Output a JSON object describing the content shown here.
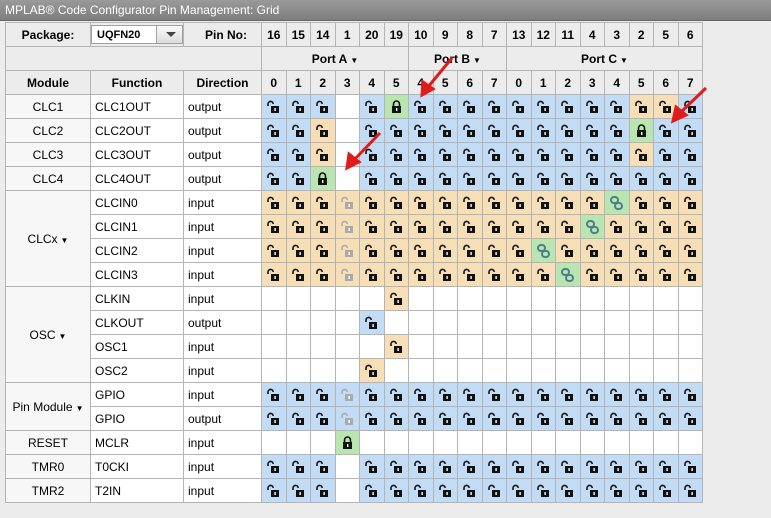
{
  "window": {
    "title": "MPLAB® Code Configurator Pin Management: Grid"
  },
  "package": {
    "label": "Package:",
    "value": "UQFN20"
  },
  "pin_no_label": "Pin No:",
  "pin_numbers": [
    "16",
    "15",
    "14",
    "1",
    "20",
    "19",
    "10",
    "9",
    "8",
    "7",
    "13",
    "12",
    "11",
    "4",
    "3",
    "2",
    "5",
    "6"
  ],
  "ports": [
    {
      "label": "Port A",
      "indices": [
        "0",
        "1",
        "2",
        "3",
        "4",
        "5"
      ]
    },
    {
      "label": "Port B",
      "indices": [
        "4",
        "5",
        "6",
        "7"
      ]
    },
    {
      "label": "Port C",
      "indices": [
        "0",
        "1",
        "2",
        "3",
        "4",
        "5",
        "6",
        "7"
      ]
    }
  ],
  "headers": {
    "module": "Module",
    "function": "Function",
    "direction": "Direction"
  },
  "modules": [
    {
      "name": "CLC1",
      "dropdown": false,
      "rows": [
        {
          "function": "CLC1OUT",
          "direction": "output",
          "cells": "bbbwbGbbbbbbbbboob"
        }
      ]
    },
    {
      "name": "CLC2",
      "dropdown": false,
      "rows": [
        {
          "function": "CLC2OUT",
          "direction": "output",
          "cells": "bbowbbbbbbbbbbbGbb"
        }
      ]
    },
    {
      "name": "CLC3",
      "dropdown": false,
      "rows": [
        {
          "function": "CLC3OUT",
          "direction": "output",
          "cells": "bbowbbbbbbbbbbbobb"
        }
      ]
    },
    {
      "name": "CLC4",
      "dropdown": false,
      "rows": [
        {
          "function": "CLC4OUT",
          "direction": "output",
          "cells": "bbGwbbbbbbbbbbbbbb"
        }
      ]
    },
    {
      "name": "CLCx",
      "dropdown": true,
      "rows": [
        {
          "function": "CLCIN0",
          "direction": "input",
          "cells": "oooxooooooooooCooo"
        },
        {
          "function": "CLCIN1",
          "direction": "input",
          "cells": "oooxoooooooooCoooo"
        },
        {
          "function": "CLCIN2",
          "direction": "input",
          "cells": "oooxoooooooCoooooo"
        },
        {
          "function": "CLCIN3",
          "direction": "input",
          "cells": "oooxooooooooCooooo"
        }
      ]
    },
    {
      "name": "OSC",
      "dropdown": true,
      "rows": [
        {
          "function": "CLKIN",
          "direction": "input",
          "cells": "wwwwwowwwwwwwwwwww"
        },
        {
          "function": "CLKOUT",
          "direction": "output",
          "cells": "wwwwbwwwwwwwwwwwww"
        },
        {
          "function": "OSC1",
          "direction": "input",
          "cells": "wwwwwowwwwwwwwwwww"
        },
        {
          "function": "OSC2",
          "direction": "input",
          "cells": "wwwwowwwwwwwwwwwww"
        }
      ]
    },
    {
      "name": "Pin Module",
      "dropdown": true,
      "rows": [
        {
          "function": "GPIO",
          "direction": "input",
          "cells": "bbbxbbbbbbbbbbbbbb"
        },
        {
          "function": "GPIO",
          "direction": "output",
          "cells": "bbbxbbbbbbbbbbbbbb"
        }
      ]
    },
    {
      "name": "RESET",
      "dropdown": false,
      "rows": [
        {
          "function": "MCLR",
          "direction": "input",
          "cells": "wwwGwwwwwwwwwwwwww"
        }
      ]
    },
    {
      "name": "TMR0",
      "dropdown": false,
      "rows": [
        {
          "function": "T0CKI",
          "direction": "input",
          "cells": "bbbwbbbbbbbbbbbbbb"
        }
      ]
    },
    {
      "name": "TMR2",
      "dropdown": false,
      "rows": [
        {
          "function": "T2IN",
          "direction": "input",
          "cells": "bbbwbbbbbbbbbbbbbb"
        }
      ]
    }
  ],
  "colors": {
    "blue": "#c3dcf6",
    "orange": "#f6dfb6",
    "green": "#b8e5b0",
    "arrow": "#e01b1b"
  }
}
